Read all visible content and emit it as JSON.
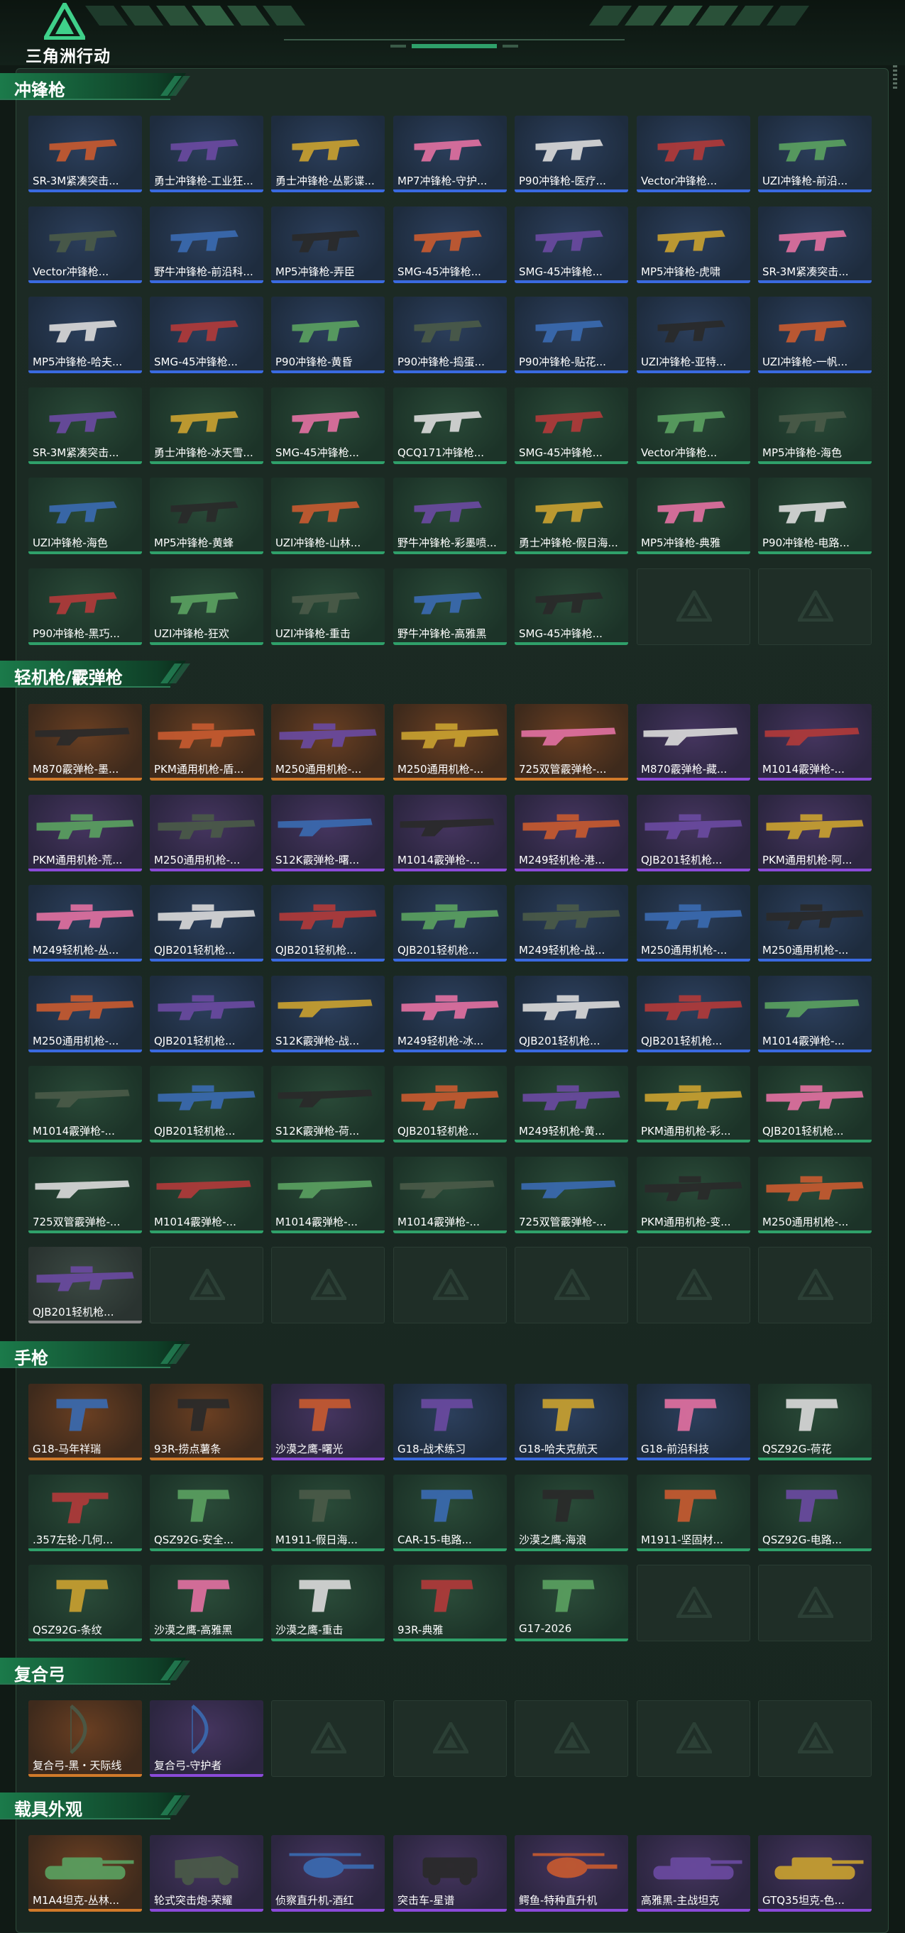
{
  "app": {
    "logo_text": "三角洲行动",
    "colors": {
      "accent": "#2fa06a",
      "tier_gold": "#d07a2a",
      "tier_purple": "#8a4ad8",
      "tier_blue": "#3a6ae0",
      "tier_green": "#2fa06a",
      "tier_gray": "#8a8a8a"
    }
  },
  "sections": [
    {
      "title": "冲锋枪",
      "rows": 6,
      "items": [
        {
          "label": "SR-3M紧凑突击...",
          "tier": "blue",
          "icon": "smg-icon"
        },
        {
          "label": "勇士冲锋枪-工业狂...",
          "tier": "blue",
          "icon": "smg-icon"
        },
        {
          "label": "勇士冲锋枪-丛影谍...",
          "tier": "blue",
          "icon": "smg-icon"
        },
        {
          "label": "MP7冲锋枪-守护...",
          "tier": "blue",
          "icon": "smg-icon"
        },
        {
          "label": "P90冲锋枪-医疗...",
          "tier": "blue",
          "icon": "smg-icon"
        },
        {
          "label": "Vector冲锋枪...",
          "tier": "blue",
          "icon": "smg-icon"
        },
        {
          "label": "UZI冲锋枪-前沿...",
          "tier": "blue",
          "icon": "smg-icon"
        },
        {
          "label": "Vector冲锋枪...",
          "tier": "blue",
          "icon": "smg-icon"
        },
        {
          "label": "野牛冲锋枪-前沿科...",
          "tier": "blue",
          "icon": "smg-icon"
        },
        {
          "label": "MP5冲锋枪-弄臣",
          "tier": "blue",
          "icon": "smg-icon"
        },
        {
          "label": "SMG-45冲锋枪...",
          "tier": "blue",
          "icon": "smg-icon"
        },
        {
          "label": "SMG-45冲锋枪...",
          "tier": "blue",
          "icon": "smg-icon"
        },
        {
          "label": "MP5冲锋枪-虎啸",
          "tier": "blue",
          "icon": "smg-icon"
        },
        {
          "label": "SR-3M紧凑突击...",
          "tier": "blue",
          "icon": "smg-icon"
        },
        {
          "label": "MP5冲锋枪-哈夫...",
          "tier": "blue",
          "icon": "smg-icon"
        },
        {
          "label": "SMG-45冲锋枪...",
          "tier": "blue",
          "icon": "smg-icon"
        },
        {
          "label": "P90冲锋枪-黄昏",
          "tier": "blue",
          "icon": "smg-icon"
        },
        {
          "label": "P90冲锋枪-捣蛋...",
          "tier": "blue",
          "icon": "smg-icon"
        },
        {
          "label": "P90冲锋枪-贴花...",
          "tier": "blue",
          "icon": "smg-icon"
        },
        {
          "label": "UZI冲锋枪-亚特...",
          "tier": "blue",
          "icon": "smg-icon"
        },
        {
          "label": "UZI冲锋枪-一帆...",
          "tier": "blue",
          "icon": "smg-icon"
        },
        {
          "label": "SR-3M紧凑突击...",
          "tier": "green",
          "icon": "smg-icon"
        },
        {
          "label": "勇士冲锋枪-冰天雪...",
          "tier": "green",
          "icon": "smg-icon"
        },
        {
          "label": "SMG-45冲锋枪...",
          "tier": "green",
          "icon": "smg-icon"
        },
        {
          "label": "QCQ171冲锋枪...",
          "tier": "green",
          "icon": "smg-icon"
        },
        {
          "label": "SMG-45冲锋枪...",
          "tier": "green",
          "icon": "smg-icon"
        },
        {
          "label": "Vector冲锋枪...",
          "tier": "green",
          "icon": "smg-icon"
        },
        {
          "label": "MP5冲锋枪-海色",
          "tier": "green",
          "icon": "smg-icon"
        },
        {
          "label": "UZI冲锋枪-海色",
          "tier": "green",
          "icon": "smg-icon"
        },
        {
          "label": "MP5冲锋枪-黄蜂",
          "tier": "green",
          "icon": "smg-icon"
        },
        {
          "label": "UZI冲锋枪-山林...",
          "tier": "green",
          "icon": "smg-icon"
        },
        {
          "label": "野牛冲锋枪-彩墨喷...",
          "tier": "green",
          "icon": "smg-icon"
        },
        {
          "label": "勇士冲锋枪-假日海...",
          "tier": "green",
          "icon": "smg-icon"
        },
        {
          "label": "MP5冲锋枪-典雅",
          "tier": "green",
          "icon": "smg-icon"
        },
        {
          "label": "P90冲锋枪-电路...",
          "tier": "green",
          "icon": "smg-icon"
        },
        {
          "label": "P90冲锋枪-黑巧...",
          "tier": "green",
          "icon": "smg-icon"
        },
        {
          "label": "UZI冲锋枪-狂欢",
          "tier": "green",
          "icon": "smg-icon"
        },
        {
          "label": "UZI冲锋枪-重击",
          "tier": "green",
          "icon": "smg-icon"
        },
        {
          "label": "野牛冲锋枪-高雅黑",
          "tier": "green",
          "icon": "smg-icon"
        },
        {
          "label": "SMG-45冲锋枪...",
          "tier": "green",
          "icon": "smg-icon"
        }
      ]
    },
    {
      "title": "轻机枪/霰弹枪",
      "rows": 7,
      "items": [
        {
          "label": "M870霰弹枪-墨...",
          "tier": "gold",
          "icon": "shotgun-icon"
        },
        {
          "label": "PKM通用机枪-盾...",
          "tier": "gold",
          "icon": "lmg-icon"
        },
        {
          "label": "M250通用机枪-...",
          "tier": "gold",
          "icon": "lmg-icon"
        },
        {
          "label": "M250通用机枪-...",
          "tier": "gold",
          "icon": "lmg-icon"
        },
        {
          "label": "725双管霰弹枪-...",
          "tier": "gold",
          "icon": "shotgun-icon"
        },
        {
          "label": "M870霰弹枪-藏...",
          "tier": "purple",
          "icon": "shotgun-icon"
        },
        {
          "label": "M1014霰弹枪-...",
          "tier": "purple",
          "icon": "shotgun-icon"
        },
        {
          "label": "PKM通用机枪-荒...",
          "tier": "purple",
          "icon": "lmg-icon"
        },
        {
          "label": "M250通用机枪-...",
          "tier": "purple",
          "icon": "lmg-icon"
        },
        {
          "label": "S12K霰弹枪-曙...",
          "tier": "purple",
          "icon": "shotgun-icon"
        },
        {
          "label": "M1014霰弹枪-...",
          "tier": "purple",
          "icon": "shotgun-icon"
        },
        {
          "label": "M249轻机枪-港...",
          "tier": "purple",
          "icon": "lmg-icon"
        },
        {
          "label": "QJB201轻机枪...",
          "tier": "purple",
          "icon": "lmg-icon"
        },
        {
          "label": "PKM通用机枪-阿...",
          "tier": "purple",
          "icon": "lmg-icon"
        },
        {
          "label": "M249轻机枪-丛...",
          "tier": "blue",
          "icon": "lmg-icon"
        },
        {
          "label": "QJB201轻机枪...",
          "tier": "blue",
          "icon": "lmg-icon"
        },
        {
          "label": "QJB201轻机枪...",
          "tier": "blue",
          "icon": "lmg-icon"
        },
        {
          "label": "QJB201轻机枪...",
          "tier": "blue",
          "icon": "lmg-icon"
        },
        {
          "label": "M249轻机枪-战...",
          "tier": "blue",
          "icon": "lmg-icon"
        },
        {
          "label": "M250通用机枪-...",
          "tier": "blue",
          "icon": "lmg-icon"
        },
        {
          "label": "M250通用机枪-...",
          "tier": "blue",
          "icon": "lmg-icon"
        },
        {
          "label": "M250通用机枪-...",
          "tier": "blue",
          "icon": "lmg-icon"
        },
        {
          "label": "QJB201轻机枪...",
          "tier": "blue",
          "icon": "lmg-icon"
        },
        {
          "label": "S12K霰弹枪-战...",
          "tier": "blue",
          "icon": "shotgun-icon"
        },
        {
          "label": "M249轻机枪-冰...",
          "tier": "blue",
          "icon": "lmg-icon"
        },
        {
          "label": "QJB201轻机枪...",
          "tier": "blue",
          "icon": "lmg-icon"
        },
        {
          "label": "QJB201轻机枪...",
          "tier": "blue",
          "icon": "lmg-icon"
        },
        {
          "label": "M1014霰弹枪-...",
          "tier": "blue",
          "icon": "shotgun-icon"
        },
        {
          "label": "M1014霰弹枪-...",
          "tier": "green",
          "icon": "shotgun-icon"
        },
        {
          "label": "QJB201轻机枪...",
          "tier": "green",
          "icon": "lmg-icon"
        },
        {
          "label": "S12K霰弹枪-荷...",
          "tier": "green",
          "icon": "shotgun-icon"
        },
        {
          "label": "QJB201轻机枪...",
          "tier": "green",
          "icon": "lmg-icon"
        },
        {
          "label": "M249轻机枪-黄...",
          "tier": "green",
          "icon": "lmg-icon"
        },
        {
          "label": "PKM通用机枪-彩...",
          "tier": "green",
          "icon": "lmg-icon"
        },
        {
          "label": "QJB201轻机枪...",
          "tier": "green",
          "icon": "lmg-icon"
        },
        {
          "label": "725双管霰弹枪-...",
          "tier": "green",
          "icon": "shotgun-icon"
        },
        {
          "label": "M1014霰弹枪-...",
          "tier": "green",
          "icon": "shotgun-icon"
        },
        {
          "label": "M1014霰弹枪-...",
          "tier": "green",
          "icon": "shotgun-icon"
        },
        {
          "label": "M1014霰弹枪-...",
          "tier": "green",
          "icon": "shotgun-icon"
        },
        {
          "label": "725双管霰弹枪-...",
          "tier": "green",
          "icon": "shotgun-icon"
        },
        {
          "label": "PKM通用机枪-变...",
          "tier": "green",
          "icon": "lmg-icon"
        },
        {
          "label": "M250通用机枪-...",
          "tier": "green",
          "icon": "lmg-icon"
        },
        {
          "label": "QJB201轻机枪...",
          "tier": "gray",
          "icon": "lmg-icon"
        }
      ]
    },
    {
      "title": "手枪",
      "rows": 3,
      "items": [
        {
          "label": "G18-马年祥瑞",
          "tier": "gold",
          "icon": "pistol-icon"
        },
        {
          "label": "93R-捞点薯条",
          "tier": "gold",
          "icon": "pistol-icon"
        },
        {
          "label": "沙漠之鹰-曙光",
          "tier": "purple",
          "icon": "pistol-icon"
        },
        {
          "label": "G18-战术练习",
          "tier": "blue",
          "icon": "pistol-icon"
        },
        {
          "label": "G18-哈夫克航天",
          "tier": "blue",
          "icon": "pistol-icon"
        },
        {
          "label": "G18-前沿科技",
          "tier": "blue",
          "icon": "pistol-icon"
        },
        {
          "label": "QSZ92G-荷花",
          "tier": "green",
          "icon": "pistol-icon"
        },
        {
          "label": ".357左轮-几何...",
          "tier": "green",
          "icon": "revolver-icon"
        },
        {
          "label": "QSZ92G-安全...",
          "tier": "green",
          "icon": "pistol-icon"
        },
        {
          "label": "M1911-假日海...",
          "tier": "green",
          "icon": "pistol-icon"
        },
        {
          "label": "CAR-15-电路...",
          "tier": "green",
          "icon": "pistol-icon"
        },
        {
          "label": "沙漠之鹰-海浪",
          "tier": "green",
          "icon": "pistol-icon"
        },
        {
          "label": "M1911-坚固材...",
          "tier": "green",
          "icon": "pistol-icon"
        },
        {
          "label": "QSZ92G-电路...",
          "tier": "green",
          "icon": "pistol-icon"
        },
        {
          "label": "QSZ92G-条纹",
          "tier": "green",
          "icon": "pistol-icon"
        },
        {
          "label": "沙漠之鹰-高雅黑",
          "tier": "green",
          "icon": "pistol-icon"
        },
        {
          "label": "沙漠之鹰-重击",
          "tier": "green",
          "icon": "pistol-icon"
        },
        {
          "label": "93R-典雅",
          "tier": "green",
          "icon": "pistol-icon"
        },
        {
          "label": "G17-2026",
          "tier": "green",
          "icon": "pistol-icon"
        }
      ]
    },
    {
      "title": "复合弓",
      "rows": 1,
      "items": [
        {
          "label": "复合弓-黑・天际线",
          "tier": "gold",
          "icon": "bow-icon"
        },
        {
          "label": "复合弓-守护者",
          "tier": "purple",
          "icon": "bow-icon"
        }
      ]
    },
    {
      "title": "载具外观",
      "rows": 1,
      "items": [
        {
          "label": "M1A4坦克-丛林...",
          "tier": "gold",
          "icon": "tank-icon"
        },
        {
          "label": "轮式突击炮-荣耀",
          "tier": "purple",
          "icon": "armored-car-icon"
        },
        {
          "label": "侦察直升机-酒红",
          "tier": "purple",
          "icon": "helicopter-icon"
        },
        {
          "label": "突击车-星谱",
          "tier": "purple",
          "icon": "assault-vehicle-icon"
        },
        {
          "label": "鳄鱼-特种直升机",
          "tier": "purple",
          "icon": "helicopter-icon"
        },
        {
          "label": "高雅黑-主战坦克",
          "tier": "purple",
          "icon": "tank-icon"
        },
        {
          "label": "GTQ35坦克-色...",
          "tier": "purple",
          "icon": "tank-icon"
        }
      ]
    }
  ]
}
